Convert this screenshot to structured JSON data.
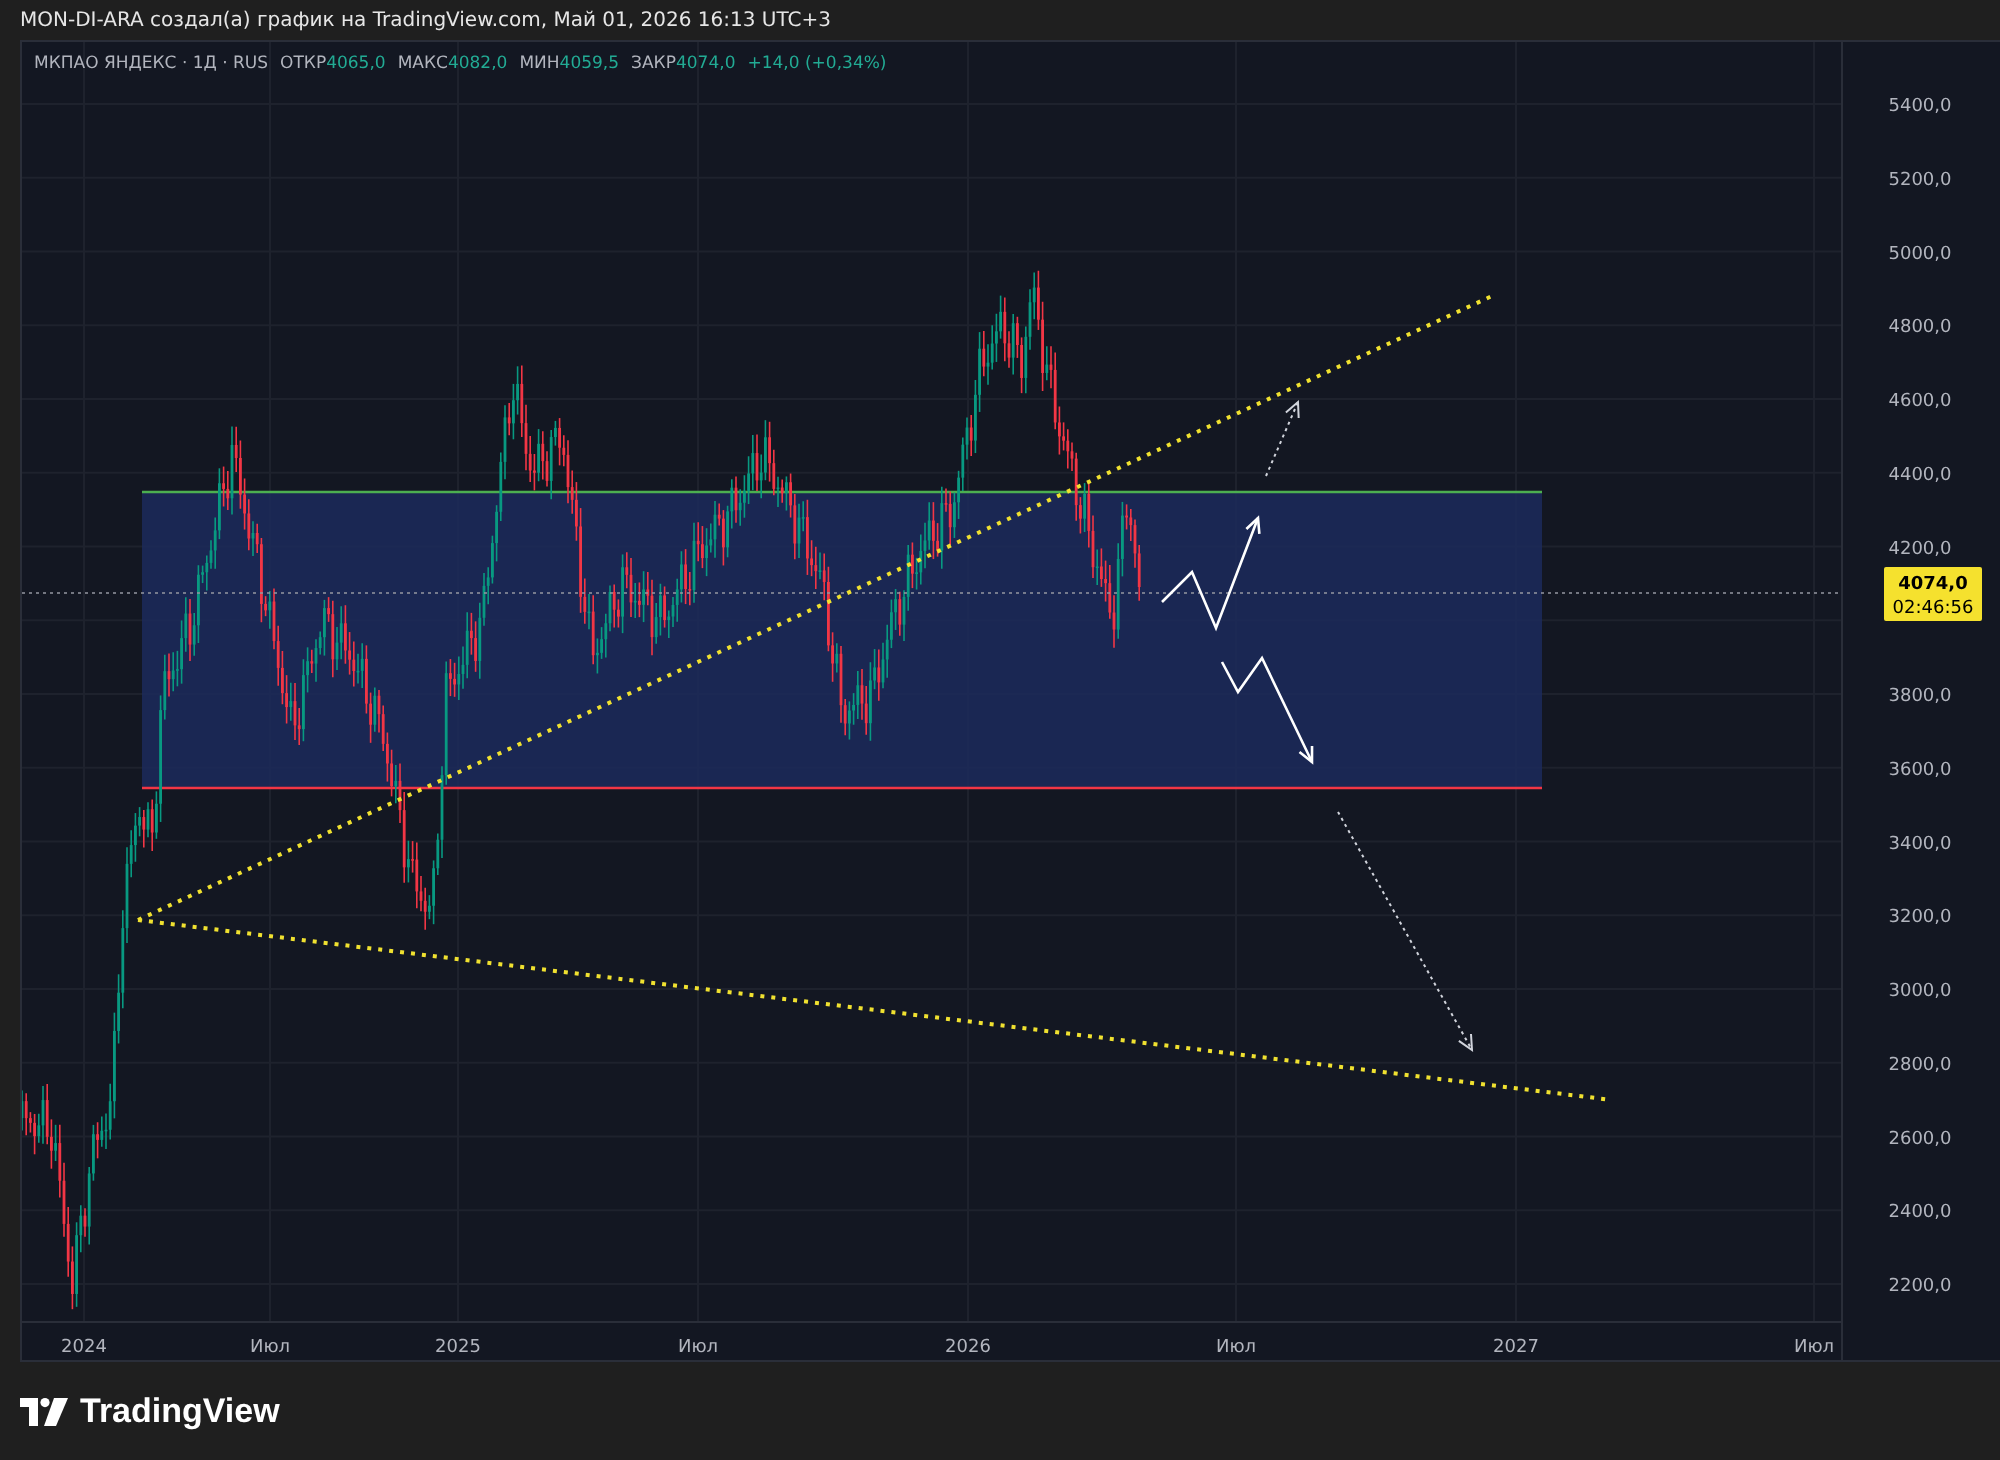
{
  "header": {
    "title": "MON-DI-ARA создал(а) график на TradingView.com, Май 01, 2026 16:13 UTC+3"
  },
  "legend": {
    "symbol": "МКПАО ЯНДЕКС · 1Д · RUS",
    "fields": [
      {
        "label": "ОТКР",
        "value": "4065,0"
      },
      {
        "label": "МАКС",
        "value": "4082,0"
      },
      {
        "label": "МИН",
        "value": "4059,5"
      },
      {
        "label": "ЗАКР",
        "value": "4074,0"
      }
    ],
    "change": "+14,0 (+0,34%)"
  },
  "price_axis": {
    "labels_above_tag": [
      "5400,0",
      "5200,0",
      "5000,0",
      "4800,0",
      "4600,0",
      "4400,0",
      "4200,0"
    ],
    "labels_below_tag": [
      "3800,0",
      "3600,0",
      "3400,0",
      "3200,0",
      "3000,0",
      "2800,0",
      "2600,0",
      "2400,0",
      "2200,0"
    ]
  },
  "last_price": {
    "price": "4074,0",
    "countdown": "02:46:56"
  },
  "time_axis": {
    "labels": [
      "2024",
      "Июл",
      "2025",
      "Июл",
      "2026",
      "Июл",
      "2027",
      "Июл"
    ]
  },
  "footer": {
    "brand": "TradingView"
  }
}
